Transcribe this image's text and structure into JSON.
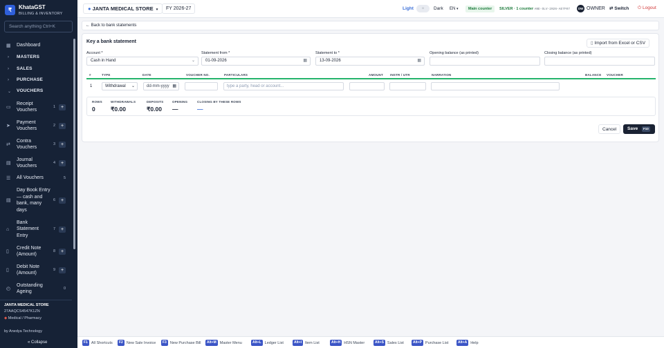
{
  "app": {
    "name": "KhataGST",
    "subtitle": "BILLING & INVENTORY",
    "logo_letter": "₹"
  },
  "sidebar": {
    "search_placeholder": "Search anything  Ctrl+K",
    "items": [
      {
        "label": "Dashboard",
        "icon": "dashboard-icon",
        "glyph": "▦"
      },
      {
        "label": "MASTERS",
        "section": true
      },
      {
        "label": "SALES",
        "section": true
      },
      {
        "label": "PURCHASE",
        "section": true
      },
      {
        "label": "VOUCHERS",
        "section": true,
        "expanded": true
      },
      {
        "label": "Receipt Vouchers",
        "num": "1",
        "icon": "receipt-icon",
        "glyph": "▭"
      },
      {
        "label": "Payment Vouchers",
        "num": "2",
        "icon": "payment-icon",
        "glyph": "➤"
      },
      {
        "label": "Contra Vouchers",
        "num": "3",
        "icon": "contra-icon",
        "glyph": "⇄"
      },
      {
        "label": "Journal Vouchers",
        "num": "4",
        "icon": "journal-icon",
        "glyph": "▤"
      },
      {
        "label": "All Vouchers",
        "num": "5",
        "icon": "all-vouchers-icon",
        "glyph": "☰"
      },
      {
        "label": "Day Book Entry — cash and bank, many days",
        "num": "6",
        "icon": "daybook-icon",
        "glyph": "▤"
      },
      {
        "label": "Bank Statement Entry",
        "num": "7",
        "icon": "bank-icon",
        "glyph": "⌂"
      },
      {
        "label": "Credit Note (Amount)",
        "num": "8",
        "icon": "credit-note-icon",
        "glyph": "▯"
      },
      {
        "label": "Debit Note (Amount)",
        "num": "9",
        "icon": "debit-note-icon",
        "glyph": "▯"
      },
      {
        "label": "Outstanding Ageing",
        "num": "0",
        "icon": "ageing-icon",
        "glyph": "◴"
      }
    ],
    "store_name": "JANTA MEDICAL STORE",
    "gstin": "27AAQCS4547K1ZN",
    "store_type": "Medical / Pharmacy",
    "by": "by Anedya Technology",
    "collapse": "« Collapse"
  },
  "topbar": {
    "store": "JANTA MEDICAL STORE",
    "fy": "FY 2026-27",
    "light": "Light",
    "dark": "Dark",
    "lang": "EN",
    "main_counter": "Main counter",
    "plan": "SILVER · 1 counter",
    "plan_code": "ANE-SLV-2026-AE7F07",
    "owner_initials": "OW",
    "owner": "OWNER",
    "switch": "Switch",
    "logout": "Logout"
  },
  "back": "← Back to bank statements",
  "form": {
    "title": "Key a bank statement",
    "import": "Import from Excel or CSV",
    "account_label": "Account *",
    "account_value": "Cash in Hand",
    "from_label": "Statement from *",
    "from_value": "01-09-2026",
    "to_label": "Statement to *",
    "to_value": "13-09-2026",
    "opening_label": "Opening balance (as printed)",
    "closing_label": "Closing balance (as printed)",
    "columns": [
      "#",
      "TYPE",
      "DATE",
      "VOUCHER NO.",
      "PARTICULARS",
      "AMOUNT",
      "INSTR / UTR",
      "NARRATION",
      "BALANCE",
      "VOUCHER"
    ],
    "row": {
      "num": "1",
      "type": "Withdrawal",
      "date_placeholder": "dd-mm-yyyy",
      "particulars_placeholder": "type a party, head or account..."
    },
    "summary": [
      {
        "key": "ROWS",
        "value": "0"
      },
      {
        "key": "WITHDRAWALS",
        "value": "₹0.00"
      },
      {
        "key": "DEPOSITS",
        "value": "₹0.00"
      },
      {
        "key": "OPENING",
        "value": "—"
      },
      {
        "key": "CLOSING BY THESE ROWS",
        "value": "—"
      }
    ],
    "cancel": "Cancel",
    "save": "Save",
    "save_key": "F10"
  },
  "shortcuts": [
    {
      "key": "F1",
      "label": "All Shortcuts"
    },
    {
      "key": "F2",
      "label": "New Sale Invoice"
    },
    {
      "key": "F3",
      "label": "New Purchase Bill"
    },
    {
      "key": "Alt+M",
      "label": "Master Menu"
    },
    {
      "key": "Alt+L",
      "label": "Ledger List"
    },
    {
      "key": "Alt+I",
      "label": "Item List"
    },
    {
      "key": "Alt+H",
      "label": "HSN Master"
    },
    {
      "key": "Alt+S",
      "label": "Sales List"
    },
    {
      "key": "Alt+P",
      "label": "Purchase List"
    },
    {
      "key": "Alt+A",
      "label": "Help"
    }
  ],
  "colors": {
    "sidebar": "#162236",
    "accent": "#3b6fd8",
    "success": "#24b36b",
    "danger": "#d23a3a"
  }
}
